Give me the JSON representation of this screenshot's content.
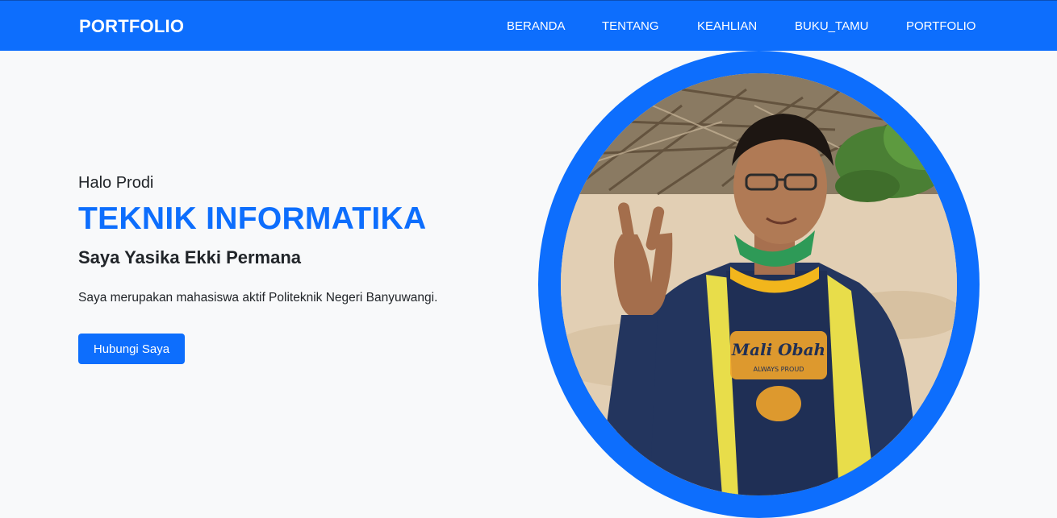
{
  "navbar": {
    "brand": "PORTFOLIO",
    "links": [
      {
        "label": "BERANDA"
      },
      {
        "label": "TENTANG"
      },
      {
        "label": "KEAHLIAN"
      },
      {
        "label": "BUKU_TAMU"
      },
      {
        "label": "PORTFOLIO"
      }
    ]
  },
  "hero": {
    "greeting": "Halo Prodi",
    "title": "TEKNIK INFORMATIKA",
    "subtitle": "Saya Yasika Ekki Permana",
    "description": "Saya merupakan mahasiswa aktif Politeknik Negeri Banyuwangi.",
    "button_label": "Hubungi Saya"
  },
  "colors": {
    "primary": "#0d6efd",
    "background": "#f8f9fa",
    "text": "#212529"
  },
  "photo": {
    "icon": "profile-photo",
    "shirt_text": "Mali Obah",
    "shirt_subtext": "ALWAYS PROUD"
  }
}
